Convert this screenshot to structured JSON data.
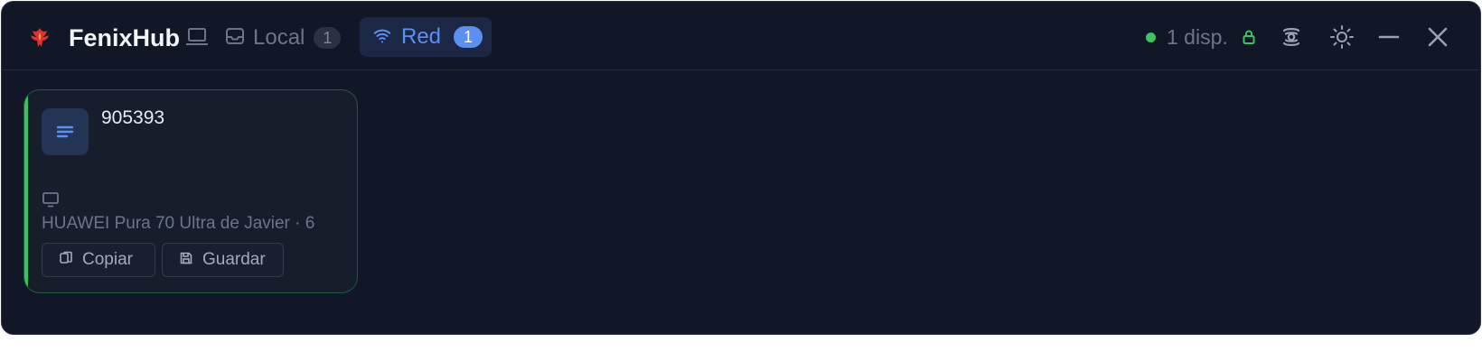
{
  "app": {
    "name": "FenixHub"
  },
  "tabs": [
    {
      "label": "Local",
      "count": "1",
      "icon": "inbox-icon",
      "active": false
    },
    {
      "label": "Red",
      "count": "1",
      "icon": "wifi-icon",
      "active": true
    }
  ],
  "status": {
    "text": "1 disp.",
    "color": "#3bc562"
  },
  "window_controls": [
    "broadcast-icon",
    "settings-icon",
    "minimize-icon",
    "close-icon"
  ],
  "card": {
    "text": "905393",
    "type_icon": "text-lines-icon",
    "device_icon": "monitor-icon",
    "device_line": "HUAWEI Pura 70 Ultra de Javier · 6",
    "buttons": {
      "copy": "Copiar",
      "save": "Guardar"
    },
    "accent_color": "#3bbf60"
  },
  "colors": {
    "accent": "#5b8ff2",
    "background": "#111726",
    "success": "#3bc562"
  }
}
